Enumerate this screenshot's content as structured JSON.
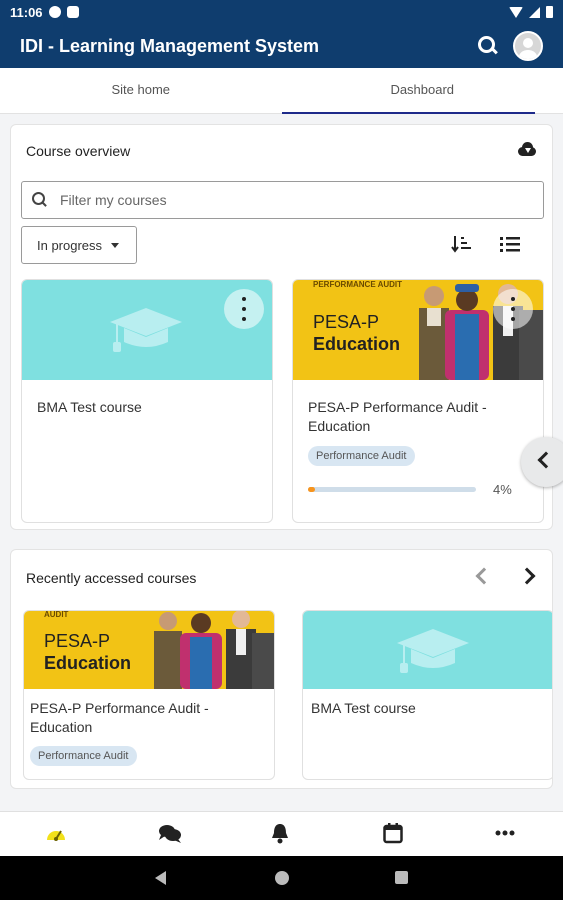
{
  "status_bar": {
    "time": "11:06"
  },
  "app": {
    "title": "IDI - Learning Management System"
  },
  "tabs": [
    {
      "label": "Site home",
      "active": false
    },
    {
      "label": "Dashboard",
      "active": true
    }
  ],
  "course_overview": {
    "title": "Course overview",
    "filter_placeholder": "Filter my courses",
    "status_select": "In progress",
    "courses": [
      {
        "name": "BMA Test course",
        "image": "graduation-cap"
      },
      {
        "name": "PESA-P Performance Audit - Education",
        "category": "Performance Audit",
        "progress_pct": 4,
        "progress_label": "4%"
      }
    ]
  },
  "pesa_banner": {
    "kicker": "PERFORMANCE AUDIT",
    "kicker_short": "AUDIT",
    "line1": "PESA-P",
    "line2": "Education"
  },
  "recently_accessed": {
    "title": "Recently accessed courses",
    "courses": [
      {
        "name": "PESA-P Performance Audit - Education",
        "category": "Performance Audit"
      },
      {
        "name": "BMA Test course"
      }
    ]
  },
  "bottom_nav": [
    "dashboard",
    "messages",
    "notifications",
    "calendar",
    "more"
  ],
  "colors": {
    "header": "#0f3d6e",
    "accent_yellow": "#f2c315",
    "teal": "#7fe0e0",
    "progress": "#f7941d"
  }
}
